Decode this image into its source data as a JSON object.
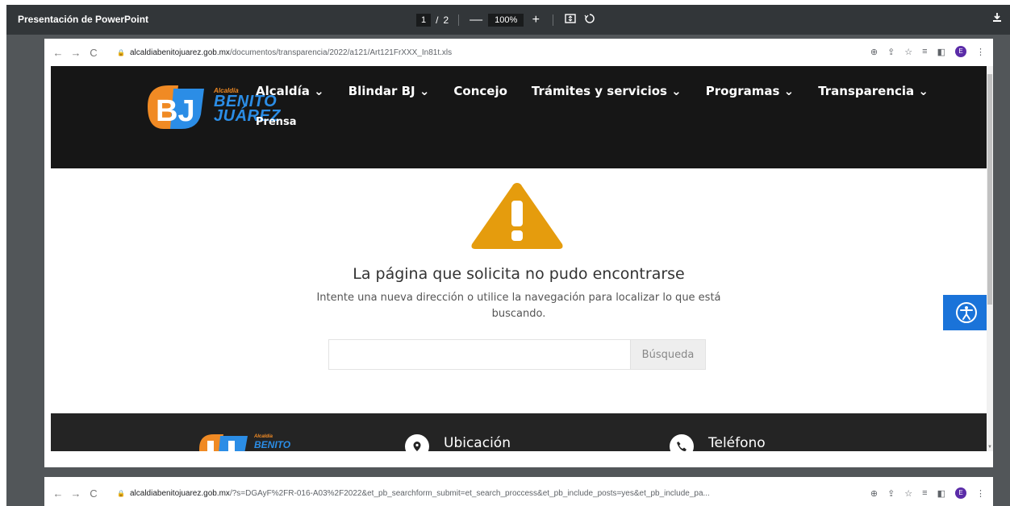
{
  "pdf_viewer": {
    "title": "Presentación de PowerPoint",
    "current_page": "1",
    "page_separator": "/",
    "total_pages": "2",
    "zoom": "100%",
    "zoom_out": "—",
    "zoom_in": "+",
    "fit_icon": "fit-page-icon",
    "rotate_icon": "rotate-icon",
    "download_icon": "download-icon"
  },
  "browser1": {
    "domain": "alcaldiabenitojuarez.gob.mx",
    "path": "/documentos/transparencia/2022/a121/Art121FrXXX_In81t.xls",
    "profile_initial": "E"
  },
  "browser2": {
    "domain": "alcaldiabenitojuarez.gob.mx",
    "path": "/?s=DGAyF%2FR-016-A03%2F2022&et_pb_searchform_submit=et_search_proccess&et_pb_include_posts=yes&et_pb_include_pa...",
    "profile_initial": "E"
  },
  "site": {
    "logo": {
      "small": "Alcaldía",
      "line1": "BENITO",
      "line2": "JUÁREZ"
    },
    "menu": [
      "Alcaldía ⌄",
      "Blindar BJ ⌄",
      "Concejo",
      "Trámites y servicios ⌄",
      "Programas ⌄",
      "Transparencia ⌄"
    ],
    "menu_second_row": "Prensa",
    "error_title": "La página que solicita no pudo encontrarse",
    "error_subtitle": "Intente una nueva dirección o utilice la navegación para localizar lo que está buscando.",
    "search_placeholder": "",
    "search_button": "Búsqueda",
    "footer": {
      "logo_small": "Alcaldía",
      "logo_line1": "BENITO",
      "location_label": "Ubicación",
      "phone_label": "Teléfono"
    }
  },
  "colors": {
    "warning": "#e59c0d",
    "accessibility": "#1a73d9",
    "header_bg": "#161616",
    "logo_blue": "#2b8de6",
    "logo_orange": "#f08a24"
  }
}
